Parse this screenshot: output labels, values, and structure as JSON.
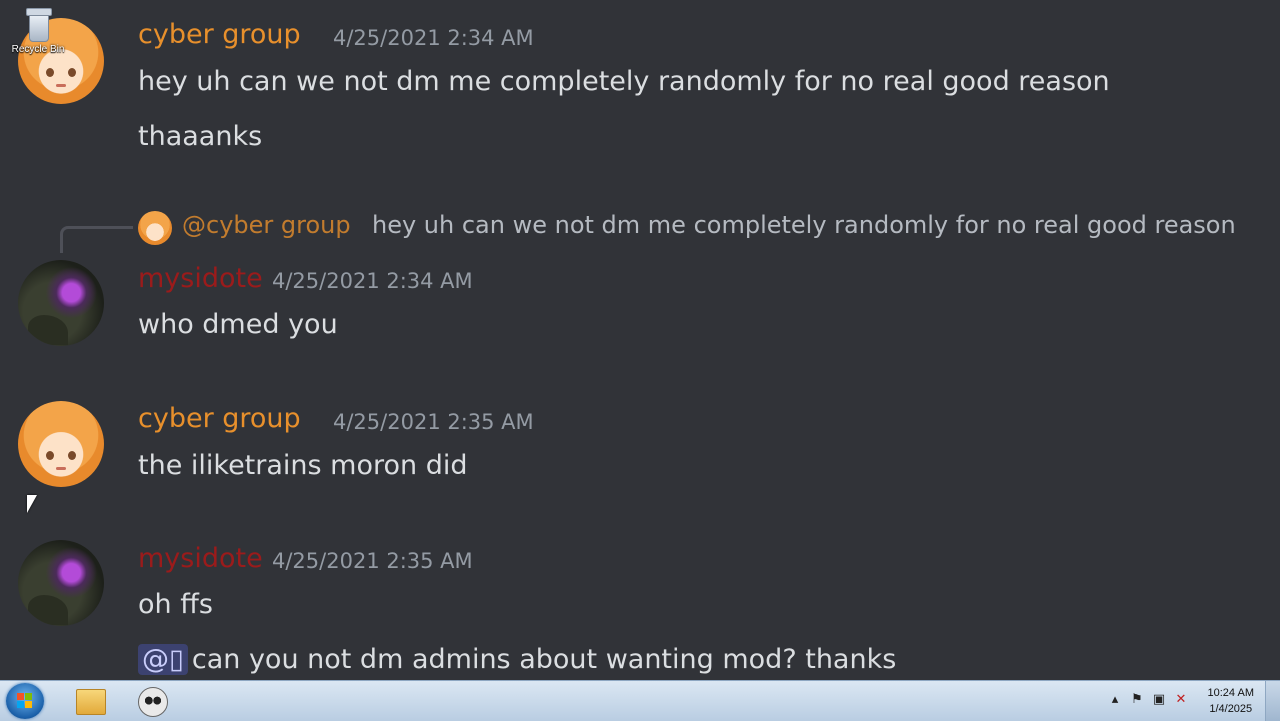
{
  "desktop": {
    "recycle_bin_label": "Recycle Bin"
  },
  "messages": [
    {
      "author": "cyber group",
      "author_color": "#e8902c",
      "timestamp": "4/25/2021 2:34 AM",
      "lines": [
        "hey uh can we not dm me completely randomly for no real good reason",
        "thaaanks"
      ]
    },
    {
      "reply": {
        "mention": "@cyber group",
        "text": "hey uh can we not dm me completely randomly for no real good reason"
      },
      "author": "mysidote",
      "author_color": "#9b1b1b",
      "timestamp": "4/25/2021 2:34 AM",
      "lines": [
        "who dmed you"
      ]
    },
    {
      "author": "cyber group",
      "author_color": "#e8902c",
      "timestamp": "4/25/2021 2:35 AM",
      "lines": [
        "the iliketrains moron did"
      ]
    },
    {
      "author": "mysidote",
      "author_color": "#9b1b1b",
      "timestamp": "4/25/2021 2:35 AM",
      "lines": [
        "oh ffs"
      ],
      "mention_line": {
        "mention": "@▯",
        "text": "can you not dm admins about wanting mod? thanks"
      }
    }
  ],
  "taskbar": {
    "clock_time": "10:24 AM",
    "clock_date": "1/4/2025",
    "tray_icons": [
      "chevron-up-icon",
      "flag-icon",
      "network-icon",
      "speaker-muted-icon"
    ]
  },
  "colors": {
    "background": "#313338",
    "text": "#dbdee1",
    "timestamp": "#949ba4"
  }
}
